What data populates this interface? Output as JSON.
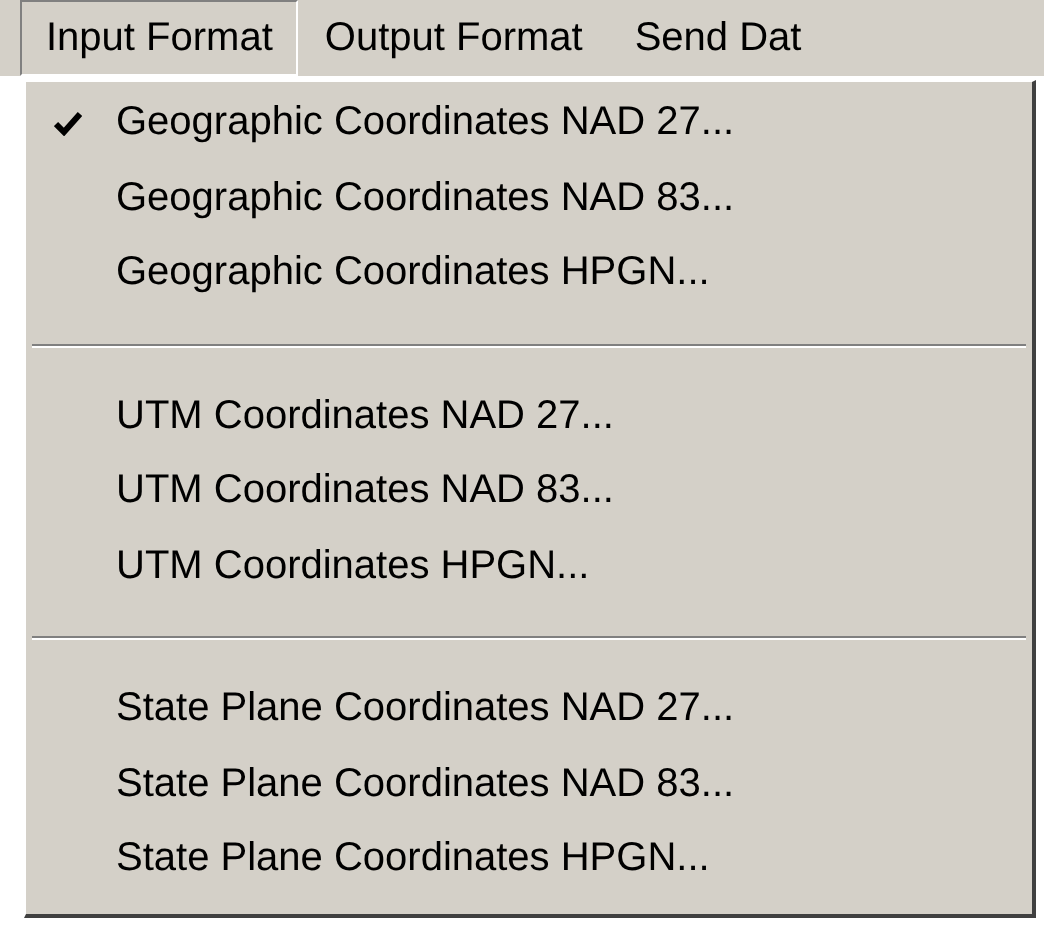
{
  "menubar": [
    {
      "label": "Input Format",
      "selected": true
    },
    {
      "label": "Output Format",
      "selected": false
    },
    {
      "label": "Send Dat",
      "selected": false
    }
  ],
  "menu": {
    "groups": [
      {
        "items": [
          {
            "label": "Geographic Coordinates NAD 27...",
            "checked": true
          },
          {
            "label": "Geographic Coordinates NAD 83...",
            "checked": false
          },
          {
            "label": "Geographic Coordinates HPGN...",
            "checked": false
          }
        ]
      },
      {
        "items": [
          {
            "label": "UTM Coordinates NAD 27...",
            "checked": false
          },
          {
            "label": "UTM Coordinates NAD 83...",
            "checked": false
          },
          {
            "label": "UTM Coordinates HPGN...",
            "checked": false
          }
        ]
      },
      {
        "items": [
          {
            "label": "State Plane Coordinates NAD 27...",
            "checked": false
          },
          {
            "label": "State Plane Coordinates NAD 83...",
            "checked": false
          },
          {
            "label": "State Plane Coordinates HPGN...",
            "checked": false
          }
        ]
      }
    ]
  }
}
